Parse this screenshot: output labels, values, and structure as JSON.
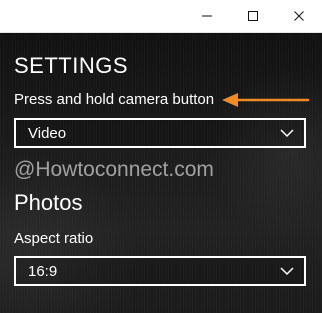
{
  "window": {
    "controls": {
      "minimize_icon": "minimize-icon",
      "maximize_icon": "maximize-icon",
      "close_icon": "close-icon"
    }
  },
  "settings": {
    "title": "SETTINGS",
    "camera_button": {
      "label": "Press and hold camera button",
      "value": "Video"
    },
    "watermark": "@Howtoconnect.com",
    "photos": {
      "title": "Photos",
      "aspect_ratio": {
        "label": "Aspect ratio",
        "value": "16:9"
      }
    }
  },
  "annotation": {
    "arrow_color": "#f08a24",
    "points_to": "Press and hold camera button"
  },
  "colors": {
    "titlebar": "#ffffff",
    "panel_dark": "#1f1f1f",
    "text": "#ffffff"
  }
}
